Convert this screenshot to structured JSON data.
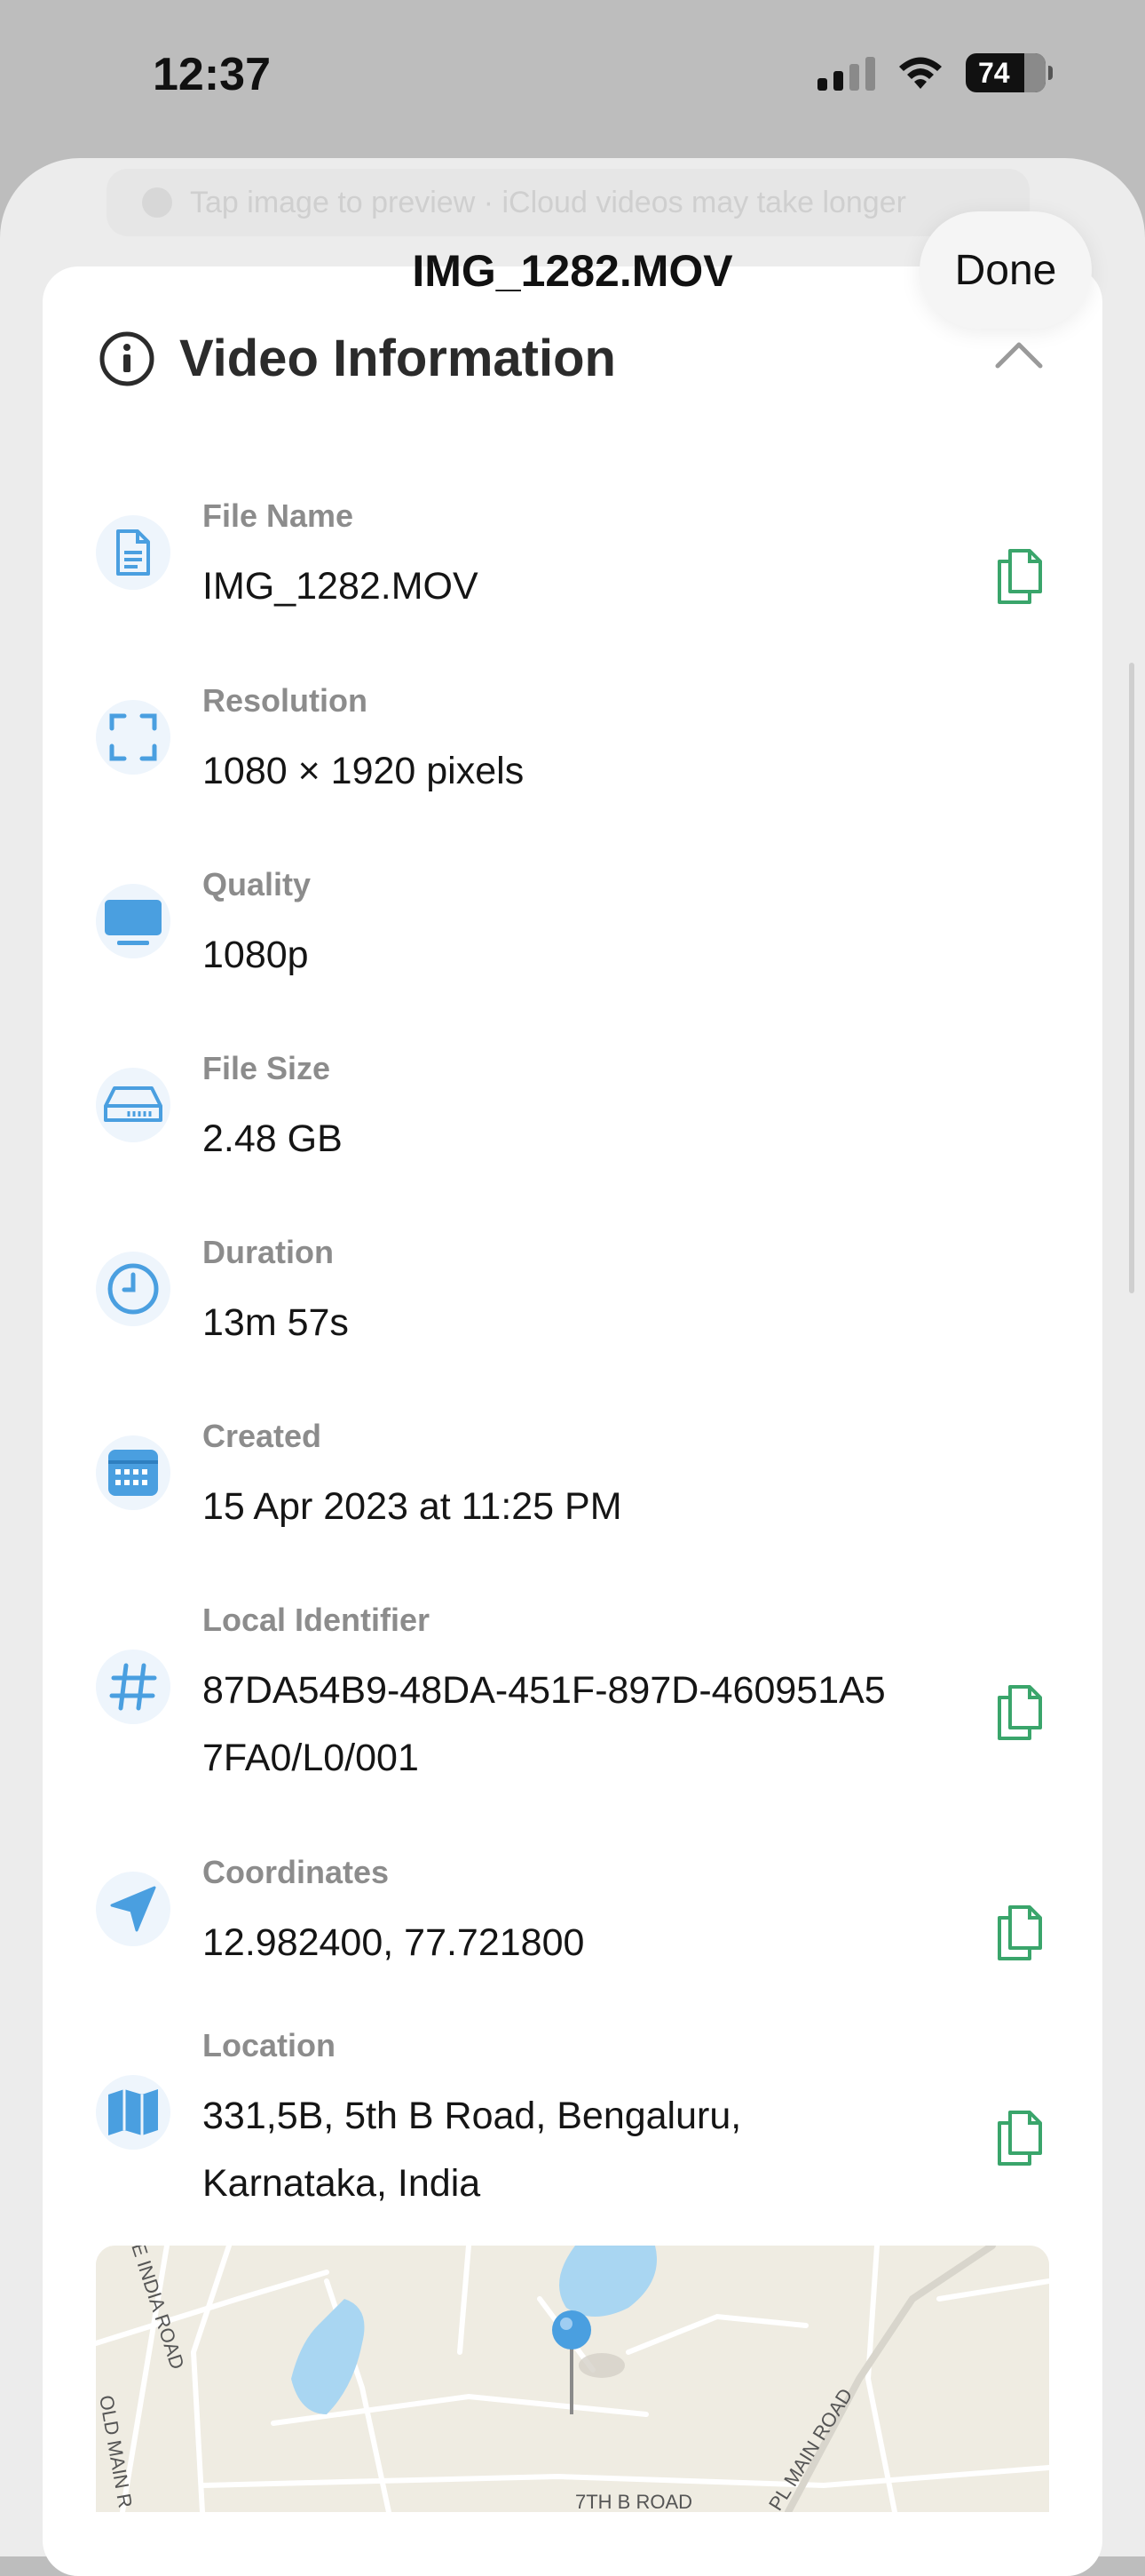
{
  "status": {
    "time": "12:37",
    "battery": "74"
  },
  "hint_bar": "Tap image to preview · iCloud videos may take longer",
  "nav": {
    "title": "IMG_1282.MOV",
    "done_label": "Done"
  },
  "section": {
    "title": "Video Information"
  },
  "fields": [
    {
      "label": "File Name",
      "value": "IMG_1282.MOV",
      "icon": "document-icon",
      "copyable": true
    },
    {
      "label": "Resolution",
      "value": "1080 × 1920 pixels",
      "icon": "resolution-frame-icon",
      "copyable": false
    },
    {
      "label": "Quality",
      "value": "1080p",
      "icon": "display-icon",
      "copyable": false
    },
    {
      "label": "File Size",
      "value": "2.48 GB",
      "icon": "drive-icon",
      "copyable": false
    },
    {
      "label": "Duration",
      "value": "13m 57s",
      "icon": "clock-icon",
      "copyable": false
    },
    {
      "label": "Created",
      "value": "15 Apr 2023 at 11:25 PM",
      "icon": "calendar-icon",
      "copyable": false
    },
    {
      "label": "Local Identifier",
      "value": "87DA54B9-48DA-451F-897D-460951A5",
      "value2": "7FA0/L0/001",
      "icon": "hash-icon",
      "copyable": true
    },
    {
      "label": "Coordinates",
      "value": "12.982400, 77.721800",
      "icon": "location-arrow-icon",
      "copyable": true
    },
    {
      "label": "Location",
      "value": "331,5B, 5th B Road, Bengaluru,",
      "value2": "Karnataka, India",
      "icon": "map-icon",
      "copyable": true
    }
  ],
  "map": {
    "labels": [
      "E INDIA ROAD",
      "PL MAIN ROAD",
      "7TH B ROAD",
      "OLD MAIN R"
    ]
  },
  "colors": {
    "accent": "#4a9fe0",
    "copy": "#3aa56b",
    "icon_bg": "#eef5fc",
    "water": "#a9d6f2"
  }
}
